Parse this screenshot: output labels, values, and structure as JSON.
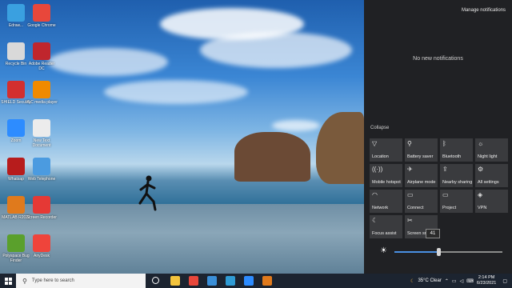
{
  "desktop": {
    "icons": [
      {
        "label": "Edraw...",
        "color": "#3aa0e0"
      },
      {
        "label": "Google Chrome",
        "color": "#e8473b"
      },
      {
        "label": "Recycle Bin",
        "color": "#d9d9d9"
      },
      {
        "label": "Adobe Reader DC",
        "color": "#c0262d"
      },
      {
        "label": "SHIELD Security",
        "color": "#d32f2f"
      },
      {
        "label": "VLC media player",
        "color": "#f08a00"
      },
      {
        "label": "Zoom",
        "color": "#2d8cff"
      },
      {
        "label": "New Text Document",
        "color": "#ececec"
      },
      {
        "label": "Whatsap",
        "color": "#b71c1c"
      },
      {
        "label": "Web Telephone",
        "color": "#4b9be0"
      },
      {
        "label": "MATLAB R2021",
        "color": "#e07a1c"
      },
      {
        "label": "Screen Recorder",
        "color": "#e53935"
      },
      {
        "label": "Polyspace Bug Finder",
        "color": "#5aa02c"
      },
      {
        "label": "AnyDesk",
        "color": "#ef443b"
      }
    ]
  },
  "action_center": {
    "manage_label": "Manage notifications",
    "empty_message": "No new notifications",
    "collapse_label": "Collapse",
    "tiles": [
      {
        "label": "Location",
        "icon": "▽"
      },
      {
        "label": "Battery saver",
        "icon": "⚲"
      },
      {
        "label": "Bluetooth",
        "icon": "ᛒ"
      },
      {
        "label": "Night light",
        "icon": "☼"
      },
      {
        "label": "Mobile hotspot",
        "icon": "((·))"
      },
      {
        "label": "Airplane mode",
        "icon": "✈"
      },
      {
        "label": "Nearby sharing",
        "icon": "⇪"
      },
      {
        "label": "All settings",
        "icon": "⚙"
      },
      {
        "label": "Network",
        "icon": "◠"
      },
      {
        "label": "Connect",
        "icon": "▭"
      },
      {
        "label": "Project",
        "icon": "▭"
      },
      {
        "label": "VPN",
        "icon": "◈"
      },
      {
        "label": "Focus assist",
        "icon": "☾"
      },
      {
        "label": "Screen snip",
        "icon": "✂"
      }
    ],
    "brightness": {
      "value": 41,
      "fraction": 0.41,
      "icon": "☀"
    }
  },
  "taskbar": {
    "search_placeholder": "Type here to search",
    "weather": "35°C  Clear",
    "time": "2:14 PM",
    "date": "6/23/2021",
    "pinned": [
      {
        "name": "task-view",
        "color": "#ffffff"
      },
      {
        "name": "file-explorer",
        "color": "#f3c33c"
      },
      {
        "name": "chrome",
        "color": "#e8473b"
      },
      {
        "name": "store",
        "color": "#3a8fd8"
      },
      {
        "name": "edge",
        "color": "#2f9bd4"
      },
      {
        "name": "zoom",
        "color": "#2d8cff"
      },
      {
        "name": "matlab",
        "color": "#e07a1c"
      }
    ]
  }
}
